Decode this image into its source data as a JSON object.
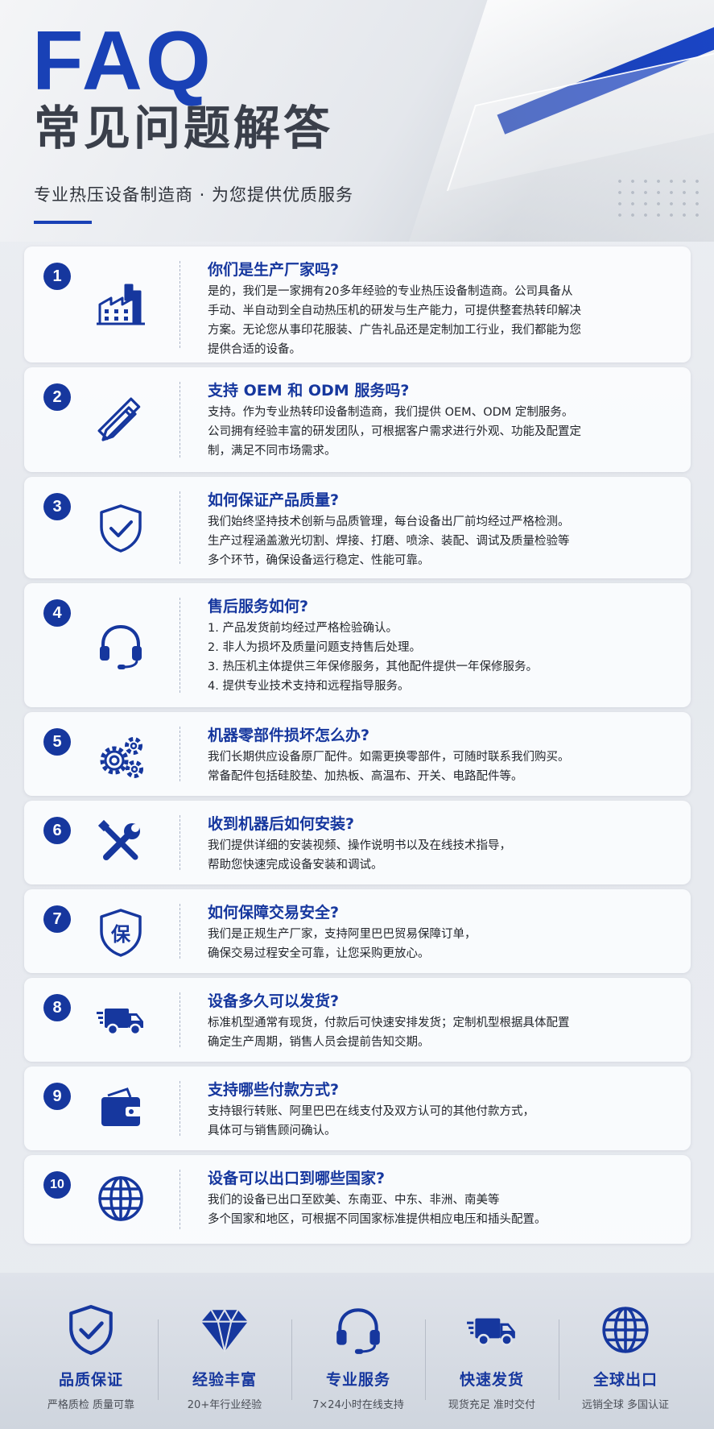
{
  "header": {
    "faq": "FAQ",
    "title": "常见问题解答",
    "subtitle": "专业热压设备制造商 · 为您提供优质服务"
  },
  "faqs": [
    {
      "num": "1",
      "icon": "factory-icon",
      "question": "你们是生产厂家吗?",
      "answer": "是的，我们是一家拥有20多年经验的专业热压设备制造商。公司具备从\n手动、半自动到全自动热压机的研发与生产能力，可提供整套热转印解决\n方案。无论您从事印花服装、广告礼品还是定制加工行业，我们都能为您\n提供合适的设备。"
    },
    {
      "num": "2",
      "icon": "design-tools-icon",
      "question": "支持 OEM 和 ODM 服务吗?",
      "answer": "支持。作为专业热转印设备制造商，我们提供 OEM、ODM 定制服务。\n公司拥有经验丰富的研发团队，可根据客户需求进行外观、功能及配置定\n制，满足不同市场需求。"
    },
    {
      "num": "3",
      "icon": "shield-check-icon",
      "question": "如何保证产品质量?",
      "answer": "我们始终坚持技术创新与品质管理，每台设备出厂前均经过严格检测。\n生产过程涵盖激光切割、焊接、打磨、喷涂、装配、调试及质量检验等\n多个环节，确保设备运行稳定、性能可靠。"
    },
    {
      "num": "4",
      "icon": "headset-icon",
      "question": "售后服务如何?",
      "answer": "1. 产品发货前均经过严格检验确认。\n2. 非人为损坏及质量问题支持售后处理。\n3. 热压机主体提供三年保修服务，其他配件提供一年保修服务。\n4. 提供专业技术支持和远程指导服务。"
    },
    {
      "num": "5",
      "icon": "gears-icon",
      "question": "机器零部件损坏怎么办?",
      "answer": "我们长期供应设备原厂配件。如需更换零部件，可随时联系我们购买。\n常备配件包括硅胶垫、加热板、高温布、开关、电路配件等。"
    },
    {
      "num": "6",
      "icon": "tools-icon",
      "question": "收到机器后如何安装?",
      "answer": "我们提供详细的安装视频、操作说明书以及在线技术指导，\n帮助您快速完成设备安装和调试。"
    },
    {
      "num": "7",
      "icon": "guarantee-shield-icon",
      "glyph": "保",
      "question": "如何保障交易安全?",
      "answer": "我们是正规生产厂家，支持阿里巴巴贸易保障订单，\n确保交易过程安全可靠，让您采购更放心。"
    },
    {
      "num": "8",
      "icon": "truck-icon",
      "question": "设备多久可以发货?",
      "answer": "标准机型通常有现货，付款后可快速安排发货；定制机型根据具体配置\n确定生产周期，销售人员会提前告知交期。"
    },
    {
      "num": "9",
      "icon": "wallet-icon",
      "question": "支持哪些付款方式?",
      "answer": "支持银行转账、阿里巴巴在线支付及双方认可的其他付款方式，\n具体可与销售顾问确认。"
    },
    {
      "num": "10",
      "icon": "globe-icon",
      "question": "设备可以出口到哪些国家?",
      "answer": "我们的设备已出口至欧美、东南亚、中东、非洲、南美等\n多个国家和地区，可根据不同国家标准提供相应电压和插头配置。"
    }
  ],
  "features": [
    {
      "icon": "shield-check-icon",
      "title": "品质保证",
      "sub": "严格质检 质量可靠"
    },
    {
      "icon": "diamond-icon",
      "title": "经验丰富",
      "sub": "20+年行业经验"
    },
    {
      "icon": "headset-icon",
      "title": "专业服务",
      "sub": "7×24小时在线支持"
    },
    {
      "icon": "truck-icon",
      "title": "快速发货",
      "sub": "现货充足 准时交付"
    },
    {
      "icon": "globe-icon",
      "title": "全球出口",
      "sub": "远销全球 多国认证"
    }
  ],
  "colors": {
    "brand_blue": "#16379e",
    "faq_blue": "#1941b6"
  }
}
